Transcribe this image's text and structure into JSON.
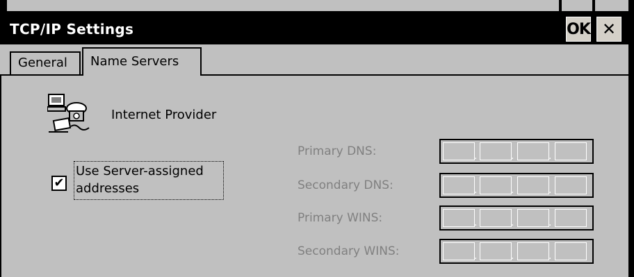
{
  "window": {
    "title": "TCP/IP Settings",
    "ok_label": "OK",
    "close_glyph": "✕"
  },
  "tabs": [
    {
      "label": "General",
      "active": false
    },
    {
      "label": "Name Servers",
      "active": true
    }
  ],
  "provider": {
    "label": "Internet Provider",
    "icon": "network-computers-icon"
  },
  "server_assigned": {
    "label": "Use Server-assigned addresses",
    "checked": true,
    "check_glyph": "✔"
  },
  "fields": [
    {
      "label": "Primary DNS:",
      "dot": "."
    },
    {
      "label": "Secondary DNS:",
      "dot": "."
    },
    {
      "label": "Primary WINS:",
      "dot": "."
    },
    {
      "label": "Secondary WINS:",
      "dot": "."
    }
  ],
  "colors": {
    "titlebar": "#000000",
    "dialog_background": "#c0c0c0",
    "disabled_text": "#808080"
  }
}
